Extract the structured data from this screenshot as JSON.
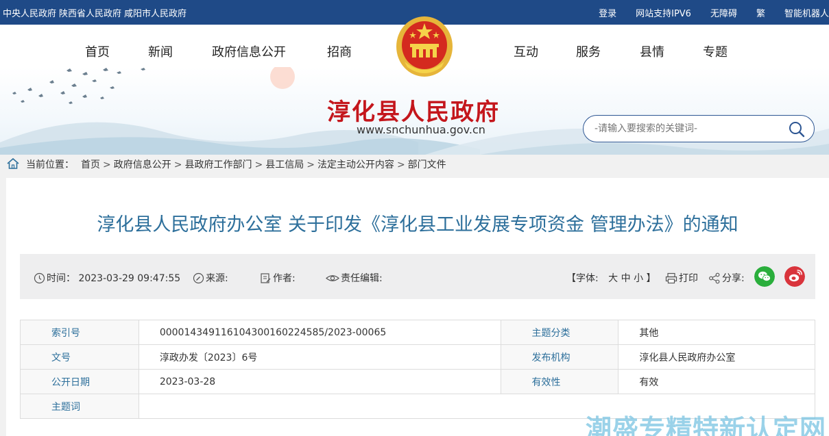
{
  "topbar": {
    "left": [
      "中央人民政府",
      "陕西省人民政府",
      "咸阳市人民政府"
    ],
    "right": [
      "登录",
      "网站支持IPV6",
      "无障碍",
      "繁",
      "智能机器人"
    ]
  },
  "nav": [
    "首页",
    "新闻",
    "政府信息公开",
    "招商",
    "互动",
    "服务",
    "县情",
    "专题"
  ],
  "banner": {
    "title": "淳化县人民政府",
    "url": "www.snchunhua.gov.cn"
  },
  "search": {
    "placeholder": "-请输入要搜索的关键词-"
  },
  "breadcrumb": {
    "label": "当前位置：",
    "path": [
      "首页",
      "政府信息公开",
      "县政府工作部门",
      "县工信局",
      "法定主动公开内容",
      "部门文件"
    ],
    "separator": ">"
  },
  "article": {
    "title": "淳化县人民政府办公室 关于印发《淳化县工业发展专项资金 管理办法》的通知"
  },
  "meta": {
    "time_label": "时间：",
    "time": "2023-03-29 09:47:55",
    "source_label": "来源:",
    "author_label": "作者:",
    "editor_label": "责任编辑:",
    "font_label": "【字体:",
    "font_large": "大",
    "font_medium": "中",
    "font_small": "小",
    "font_close": "】",
    "print": "打印",
    "share": "分享:"
  },
  "info": {
    "rows": [
      {
        "k1": "索引号",
        "v1": "000014349116104300160224585/2023-00065",
        "k2": "主题分类",
        "v2": "其他"
      },
      {
        "k1": "文号",
        "v1": "淳政办发〔2023〕6号",
        "k2": "发布机构",
        "v2": "淳化县人民政府办公室"
      },
      {
        "k1": "公开日期",
        "v1": "2023-03-28",
        "k2": "有效性",
        "v2": "有效"
      },
      {
        "k1": "主题词",
        "v1": "",
        "k2": "",
        "v2": ""
      }
    ]
  },
  "watermark": "潮盛专精特新认定网",
  "colors": {
    "topbar": "#1f4a87",
    "title_red": "#c4161c",
    "article_title": "#2d6f9b",
    "wechat": "#2aae3c",
    "weibo": "#d9343c"
  }
}
